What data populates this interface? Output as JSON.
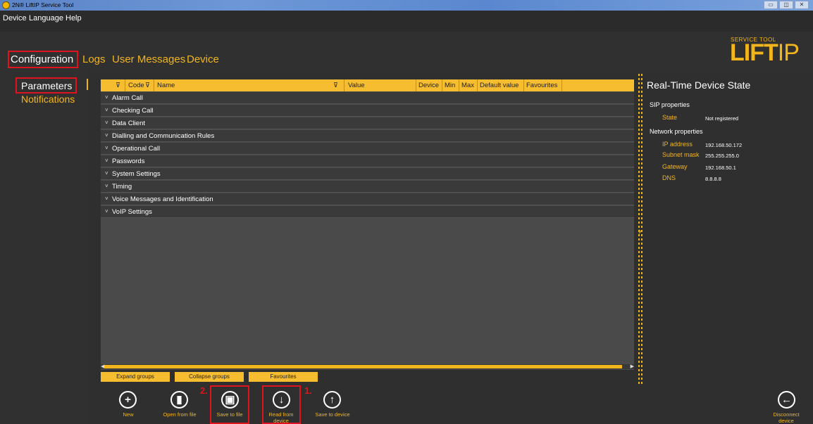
{
  "window": {
    "title": "2N® LiftIP Service Tool",
    "buttons": [
      "▭",
      "◫",
      "✕"
    ]
  },
  "menu": [
    "Device",
    "Language",
    "Help"
  ],
  "nav_tabs": [
    {
      "label": "Configuration"
    },
    {
      "label": "Logs"
    },
    {
      "label": "User Messages"
    },
    {
      "label": "Device"
    }
  ],
  "logo": {
    "small": "SERVICE TOOL",
    "big": "LIFT",
    "suffix": "IP"
  },
  "left_nav": [
    {
      "label": "Parameters"
    },
    {
      "label": "Notifications"
    }
  ],
  "grid": {
    "headers": [
      "Code",
      "Name",
      "Value",
      "Device",
      "Min",
      "Max",
      "Default value",
      "Favourites"
    ],
    "groups": [
      "Alarm Call",
      "Checking Call",
      "Data Client",
      "Dialling and Communication Rules",
      "Operational Call",
      "Passwords",
      "System Settings",
      "Timing",
      "Voice Messages and Identification",
      "VoIP Settings"
    ]
  },
  "bottom_buttons": [
    "Expand groups",
    "Collapse groups",
    "Favourites"
  ],
  "actions": [
    {
      "label": "New",
      "glyph": "+"
    },
    {
      "label": "Open from file",
      "glyph": "▮"
    },
    {
      "label": "Save to file",
      "glyph": "▣"
    },
    {
      "label": "Read from device",
      "glyph": "↓"
    },
    {
      "label": "Save to device",
      "glyph": "↑"
    },
    {
      "label": "Disconnect device",
      "glyph": "←"
    }
  ],
  "annotations": {
    "step1": "1.",
    "step2": "2."
  },
  "realtime": {
    "title": "Real-Time Device State",
    "sip_title": "SIP properties",
    "state_key": "State",
    "state_val": "Not registered",
    "net_title": "Network properties",
    "rows": [
      {
        "key": "IP address",
        "val": "192.168.50.172"
      },
      {
        "key": "Subnet mask",
        "val": "255.255.255.0"
      },
      {
        "key": "Gateway",
        "val": "192.168.50.1"
      },
      {
        "key": "DNS",
        "val": "8.8.8.8"
      }
    ]
  },
  "colors": {
    "accent": "#f3b51c",
    "header": "#f6bd31",
    "highlight": "#e0141e",
    "bg": "#2f2f2f"
  }
}
